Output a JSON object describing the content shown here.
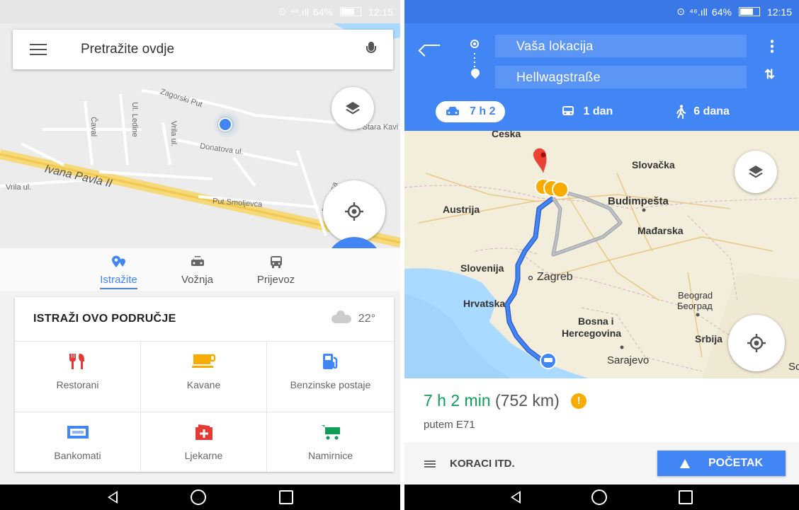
{
  "left": {
    "status": {
      "signal": "⁴⁶.ıll",
      "battery": "64%",
      "time": "12:15"
    },
    "search": {
      "placeholder": "Pretražite ovdje"
    },
    "map_labels": [
      "Zagorski Put",
      "Ul. Ledine",
      "Čaval",
      "Vrila ul.",
      "Donatova ul.",
      "Ivana Pavla II",
      "Vrila ul.",
      "Put Smoljevca",
      "Put Kosa",
      "Ul. Stara Kavi"
    ],
    "tabs": [
      {
        "label": "Istražite",
        "active": true,
        "icon": "explore-pin-icon"
      },
      {
        "label": "Vožnja",
        "active": false,
        "icon": "car-icon"
      },
      {
        "label": "Prijevoz",
        "active": false,
        "icon": "bus-icon"
      }
    ],
    "card": {
      "title": "ISTRAŽI OVO PODRUČJE",
      "temperature": "22°",
      "categories": [
        {
          "label": "Restorani",
          "icon": "restaurant-icon",
          "color": "#e53935"
        },
        {
          "label": "Kavane",
          "icon": "coffee-icon",
          "color": "#f9ab00"
        },
        {
          "label": "Benzinske postaje",
          "icon": "gas-station-icon",
          "color": "#4285f4"
        },
        {
          "label": "Bankomati",
          "icon": "atm-icon",
          "color": "#4285f4"
        },
        {
          "label": "Ljekarne",
          "icon": "pharmacy-icon",
          "color": "#e53935"
        },
        {
          "label": "Namirnice",
          "icon": "grocery-cart-icon",
          "color": "#0f9d58"
        }
      ]
    }
  },
  "right": {
    "status": {
      "signal": "⁴⁶.ıll",
      "battery": "64%",
      "time": "12:15"
    },
    "origin": "Vaša lokacija",
    "destination": "Hellwagstraße",
    "modes": [
      {
        "label": "7 h 2",
        "icon": "car-icon",
        "active": true
      },
      {
        "label": "1 dan",
        "icon": "transit-icon",
        "active": false
      },
      {
        "label": "6 dana",
        "icon": "walk-icon",
        "active": false
      }
    ],
    "map_labels": [
      "Česka",
      "Slovačka",
      "Austrija",
      "Budimpešta",
      "Mađarska",
      "Slovenija",
      "Zagreb",
      "Beograd",
      "Београд",
      "Hrvatska",
      "Bosna i",
      "Hercegovina",
      "Srbija",
      "Sarajevo",
      "Sc"
    ],
    "route": {
      "duration": "7 h 2 min",
      "distance": "(752 km)",
      "via": "putem E71"
    },
    "steps_label": "KORACI ITD.",
    "start_label": "POČETAK"
  },
  "colors": {
    "accent": "#4285f4",
    "route": "#4285f4",
    "duration": "#0f9d58"
  }
}
